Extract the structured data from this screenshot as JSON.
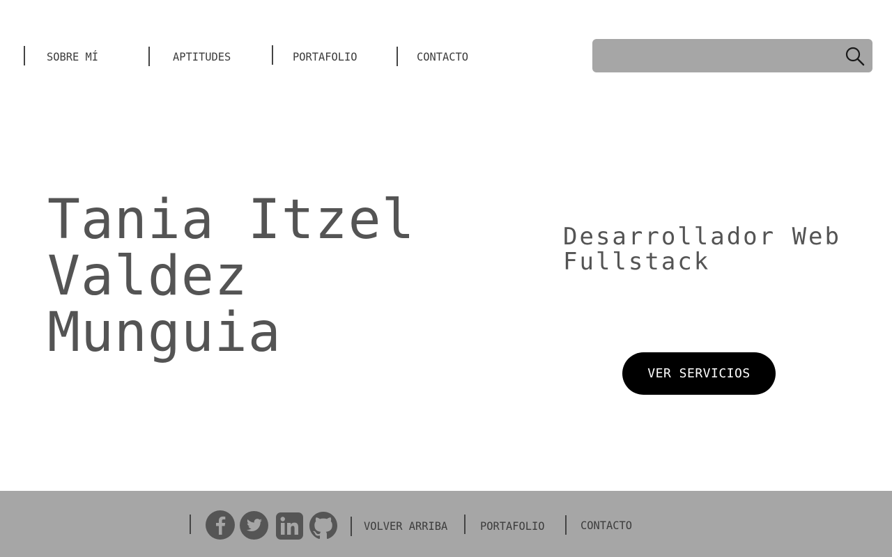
{
  "nav": {
    "items": [
      {
        "label": "SOBRE MÍ"
      },
      {
        "label": "APTITUDES"
      },
      {
        "label": "PORTAFOLIO"
      },
      {
        "label": "CONTACTO"
      }
    ]
  },
  "search": {
    "placeholder": "",
    "value": "",
    "icon": "search-icon"
  },
  "hero": {
    "name_lines": [
      "Tania Itzel",
      "Valdez",
      "Munguia"
    ],
    "role_lines": [
      "Desarrollador Web",
      "Fullstack"
    ],
    "cta_label": "VER SERVICIOS"
  },
  "footer": {
    "social": [
      {
        "icon": "facebook-icon"
      },
      {
        "icon": "twitter-icon"
      },
      {
        "icon": "linkedin-icon"
      },
      {
        "icon": "github-icon"
      }
    ],
    "links": [
      {
        "label": "VOLVER ARRIBA"
      },
      {
        "label": "PORTAFOLIO"
      },
      {
        "label": "CONTACTO"
      }
    ]
  },
  "colors": {
    "background": "#ffffff",
    "text": "#545454",
    "search_bg": "#a6a6a6",
    "footer_bg": "#a6a6a6",
    "button_bg": "#000000",
    "button_text": "#ffffff",
    "icon_color": "#555555"
  }
}
